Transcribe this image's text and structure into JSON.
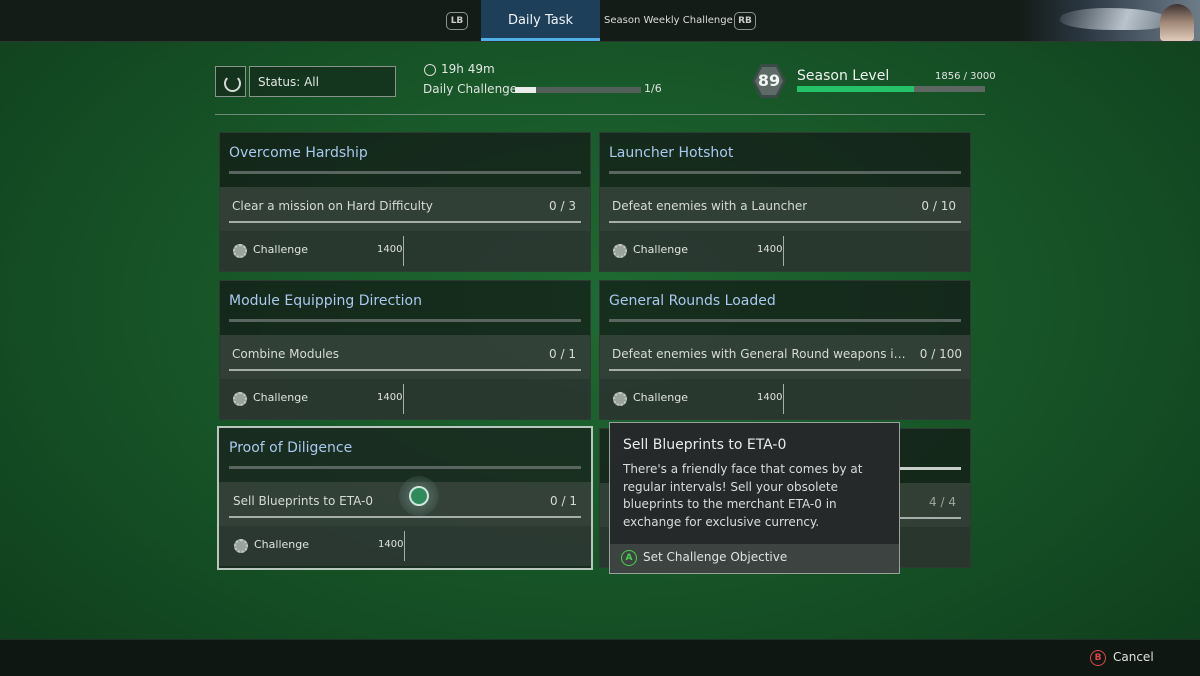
{
  "tabs": {
    "lb": "LB",
    "rb": "RB",
    "active": "Daily Task",
    "inactive": "Season Weekly Challenge"
  },
  "header": {
    "status_filter": "Status: All",
    "timer": "19h 49m",
    "daily_label": "Daily Challenge",
    "daily_count": "1/6",
    "daily_progress": 0.17,
    "level": "89",
    "season_label": "Season Level",
    "season_count": "1856 / 3000",
    "season_progress": 0.62
  },
  "cards": [
    {
      "title": "Overcome Hardship",
      "objective": "Clear a mission on Hard Difficulty",
      "progress": "0 / 3",
      "reward_label": "Challenge",
      "reward_value": "1400"
    },
    {
      "title": "Launcher Hotshot",
      "objective": "Defeat enemies with a Launcher",
      "progress": "0 / 10",
      "reward_label": "Challenge",
      "reward_value": "1400"
    },
    {
      "title": "Module Equipping Direction",
      "objective": "Combine Modules",
      "progress": "0 / 1",
      "reward_label": "Challenge",
      "reward_value": "1400"
    },
    {
      "title": "General Rounds Loaded",
      "objective": "Defeat enemies with General Round weapons in In…",
      "progress": "0 / 100",
      "reward_label": "Challenge",
      "reward_value": "1400"
    },
    {
      "title": "Proof of Diligence",
      "objective": "Sell Blueprints to ETA-0",
      "progress": "0 / 1",
      "reward_label": "Challenge",
      "reward_value": "1400"
    },
    {
      "title": "",
      "objective": "",
      "progress": "4 / 4",
      "reward_label": "",
      "reward_value": ""
    }
  ],
  "tooltip": {
    "title": "Sell Blueprints to ETA-0",
    "description": "There's a friendly face that comes by at regular intervals! Sell your obsolete blueprints to the merchant ETA-0 in exchange for exclusive currency.",
    "action_button": "A",
    "action_label": "Set Challenge Objective"
  },
  "footer": {
    "cancel_button": "B",
    "cancel_label": "Cancel"
  },
  "colors": {
    "accent_blue": "#4fb0e8",
    "season_green": "#26c26a",
    "title_blue": "#a9c9ee"
  }
}
